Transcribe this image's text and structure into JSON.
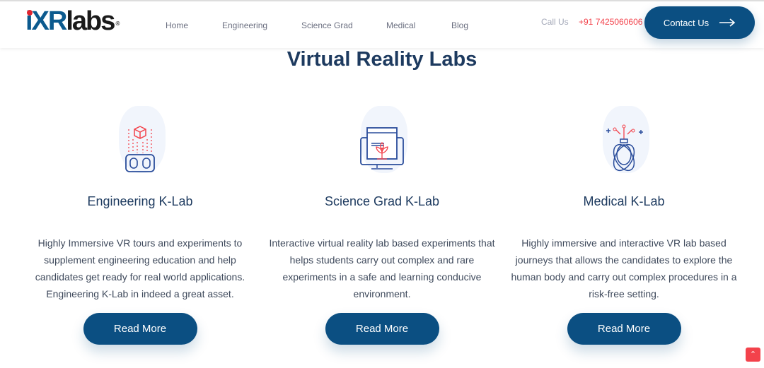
{
  "header": {
    "logo": {
      "part1": "iXR",
      "part2": "labs",
      "reg": "®"
    },
    "nav": [
      "Home",
      "Engineering",
      "Science Grad",
      "Medical",
      "Blog"
    ],
    "call_label": "Call Us",
    "phone": "+91 7425060606",
    "contact_label": "Contact Us"
  },
  "main": {
    "title": "Virtual Reality Labs",
    "cards": [
      {
        "icon": "vr-headset-icon",
        "title": "Engineering K-Lab",
        "text": "Highly Immersive VR tours and experiments to supplement engineering education and help candidates get ready for real world applications. Engineering K-Lab in indeed a great asset.",
        "button": "Read More"
      },
      {
        "icon": "monitor-plant-icon",
        "title": "Science Grad K-Lab",
        "text": "Interactive virtual reality lab based experiments that helps students carry out complex and rare experiments in a safe and learning conducive environment.",
        "button": "Read More"
      },
      {
        "icon": "flask-atom-icon",
        "title": "Medical K-Lab",
        "text": "Highly immersive and interactive VR lab based journeys that allows the candidates to explore the human body and carry out complex procedures in a risk-free setting.",
        "button": "Read More"
      }
    ]
  },
  "colors": {
    "primary": "#0b4f82",
    "accent": "#f3424b",
    "heading": "#1d3a5f"
  }
}
